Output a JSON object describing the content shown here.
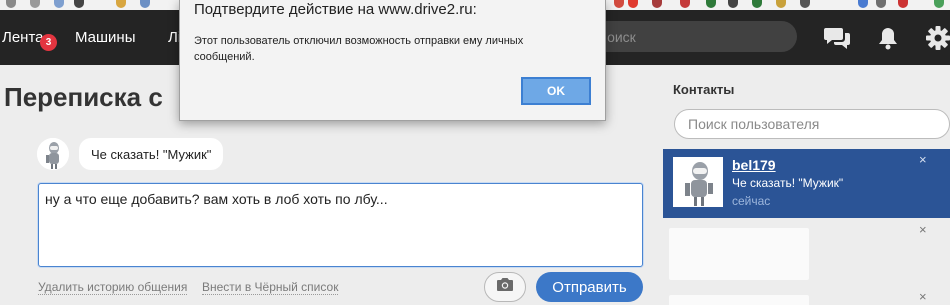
{
  "dialog": {
    "title": "Подтвердите действие на www.drive2.ru:",
    "message": "Этот пользователь отключил возможность отправки ему личных сообщений.",
    "ok_label": "OK"
  },
  "header": {
    "nav": [
      {
        "label": "Лента",
        "badge": "3"
      },
      {
        "label": "Машины"
      },
      {
        "label": "Лі"
      }
    ],
    "search_placeholder": "Поиск"
  },
  "page": {
    "title": "Переписка с"
  },
  "conversation": {
    "messages": [
      {
        "text": "Че сказать! \"Мужик\""
      }
    ],
    "compose_value": "ну а что еще добавить? вам хоть в лоб хоть по лбу...",
    "clear_history_label": "Удалить историю общения",
    "blacklist_label": "Внести в Чёрный список",
    "send_label": "Отправить"
  },
  "contacts": {
    "title": "Контакты",
    "search_placeholder": "Поиск пользователя",
    "close_symbol": "×",
    "items": [
      {
        "name": "bel179",
        "last_message": "Че сказать! \"Мужик\"",
        "time": "сейчас"
      }
    ]
  },
  "colors": {
    "header_bg": "#242424",
    "accent_blue": "#3c78c8",
    "contact_selected": "#2b5496",
    "badge_red": "#e33540"
  }
}
